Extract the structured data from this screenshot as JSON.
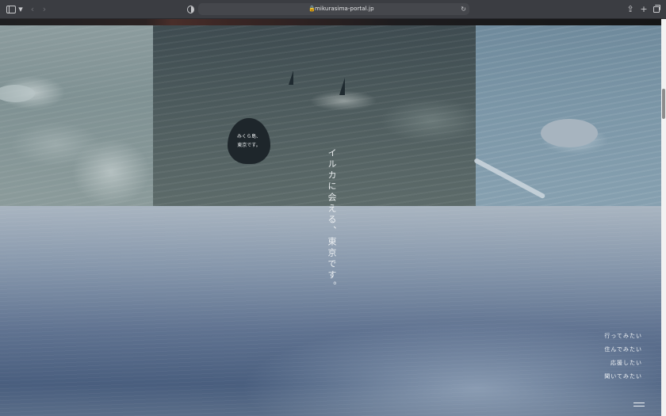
{
  "browser": {
    "url": "mikurasima-portal.jp",
    "icons": {
      "sidebar": "sidebar-icon",
      "back": "‹",
      "forward": "›",
      "lock": "🔒",
      "reload": "↻",
      "share": "⇪",
      "new_tab": "+",
      "tabs": "tabs-icon"
    }
  },
  "hero": {
    "mascot_text": [
      "みくら島、",
      "東京です。"
    ],
    "tagline": "イルカに会える、東京です。"
  },
  "menu": {
    "items": [
      {
        "label": "行ってみたい"
      },
      {
        "label": "住んでみたい"
      },
      {
        "label": "応援したい"
      },
      {
        "label": "聞いてみたい"
      }
    ]
  }
}
